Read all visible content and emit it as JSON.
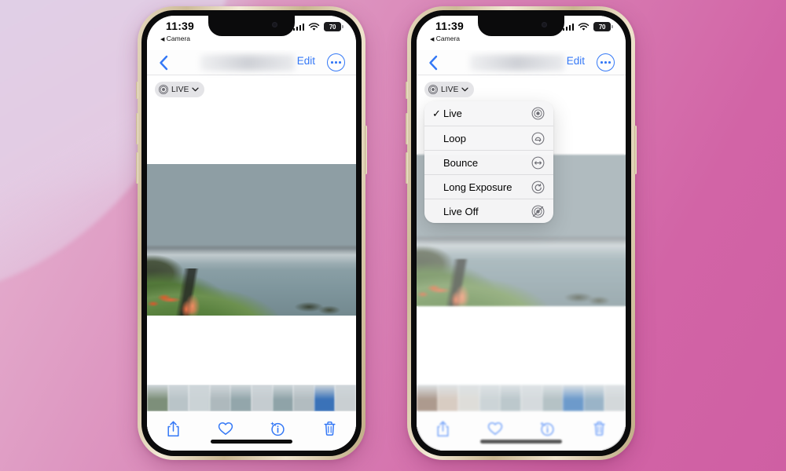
{
  "background": {
    "primary_color": "#d87fb4",
    "accent_color": "#d264a6",
    "swirl_color": "#ded7ec"
  },
  "theme": {
    "tint_color": "#3478f6",
    "menu_bg": "#f6f6f7",
    "badge_bg": "#e2e2e5"
  },
  "phones": [
    {
      "id": "phone-left",
      "status_bar": {
        "time": "11:39",
        "back_label": "Camera",
        "back_arrow": "◀",
        "battery_level": "70",
        "cellular_icon": "cellular-bars-icon",
        "wifi_icon": "wifi-icon",
        "battery_icon": "battery-icon"
      },
      "nav_bar": {
        "back_icon": "chevron-left-icon",
        "edit_label": "Edit",
        "more_icon": "ellipsis-circle-icon",
        "title": ""
      },
      "live_badge": {
        "label": "LIVE",
        "icon": "live-photo-icon",
        "chevron": "chevron-down-icon"
      },
      "menu_open": false,
      "toolbar": [
        {
          "name": "share-button",
          "icon": "share-icon"
        },
        {
          "name": "favorite-button",
          "icon": "heart-icon"
        },
        {
          "name": "info-button",
          "icon": "info-sparkle-icon"
        },
        {
          "name": "delete-button",
          "icon": "trash-icon"
        }
      ]
    },
    {
      "id": "phone-right",
      "status_bar": {
        "time": "11:39",
        "back_label": "Camera",
        "back_arrow": "◀",
        "battery_level": "70",
        "cellular_icon": "cellular-bars-icon",
        "wifi_icon": "wifi-icon",
        "battery_icon": "battery-icon"
      },
      "nav_bar": {
        "back_icon": "chevron-left-icon",
        "edit_label": "Edit",
        "more_icon": "ellipsis-circle-icon",
        "title": ""
      },
      "live_badge": {
        "label": "LIVE",
        "icon": "live-photo-icon",
        "chevron": "chevron-down-icon"
      },
      "menu_open": true,
      "toolbar": [
        {
          "name": "share-button",
          "icon": "share-icon"
        },
        {
          "name": "favorite-button",
          "icon": "heart-icon"
        },
        {
          "name": "info-button",
          "icon": "info-sparkle-icon"
        },
        {
          "name": "delete-button",
          "icon": "trash-icon"
        }
      ]
    }
  ],
  "live_menu": {
    "items": [
      {
        "label": "Live",
        "selected": true,
        "check": "✓",
        "icon": "live-photo-icon"
      },
      {
        "label": "Loop",
        "selected": false,
        "check": "",
        "icon": "loop-icon"
      },
      {
        "label": "Bounce",
        "selected": false,
        "check": "",
        "icon": "bounce-icon"
      },
      {
        "label": "Long Exposure",
        "selected": false,
        "check": "",
        "icon": "long-exposure-icon"
      },
      {
        "label": "Live Off",
        "selected": false,
        "check": "",
        "icon": "live-off-icon"
      }
    ]
  },
  "thumbnails": {
    "left": [
      "#7d8f7a",
      "#b9c4c8",
      "#cbd3d6",
      "#aeb9bd",
      "#93a6ab",
      "#c5ccd0",
      "#8fa3a8",
      "#b2bcc0",
      "#3a72b8",
      "#c9cfd2"
    ],
    "right": [
      "#8a6f5d",
      "#c8b6a8",
      "#d0cfc9",
      "#b7c2c6",
      "#9fb0b6",
      "#c3cbcf",
      "#95a8ad",
      "#2f6fb5",
      "#6f94b0",
      "#c0c7ca"
    ]
  }
}
